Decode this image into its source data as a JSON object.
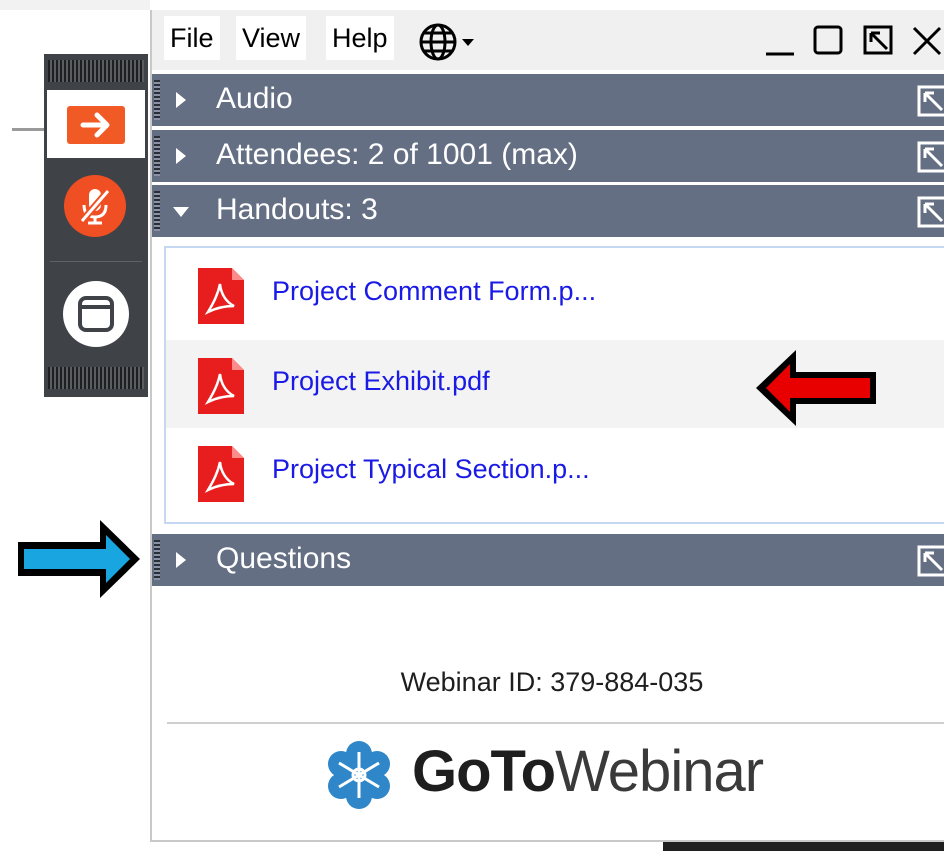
{
  "menu": {
    "file": "File",
    "view": "View",
    "help": "Help",
    "language_icon": "globe-icon"
  },
  "window_controls": [
    "minimize-icon",
    "maximize-icon",
    "popout-icon",
    "close-icon"
  ],
  "dock": {
    "buttons": [
      {
        "name": "leave-session",
        "icon": "exit-arrow-icon",
        "color": "#f15a24"
      },
      {
        "name": "microphone",
        "icon": "muted-mic-icon",
        "color": "#f04e23"
      },
      {
        "name": "show-panel",
        "icon": "window-icon",
        "color": "#ffffff"
      }
    ]
  },
  "sections": {
    "audio": "Audio",
    "attendees": "Attendees:  2 of 1001 (max)",
    "handouts": "Handouts: 3",
    "questions": "Questions"
  },
  "handouts": [
    {
      "name": "Project Comment Form.p..."
    },
    {
      "name": "Project Exhibit.pdf"
    },
    {
      "name": "Project Typical Section.p..."
    }
  ],
  "webinar_id": "Webinar ID: 379-884-035",
  "brand": {
    "bold": "GoTo",
    "light": "Webinar"
  },
  "colors": {
    "section_header": "#656f84",
    "link": "#1a1ae6",
    "accent_orange": "#f15a24",
    "annotation_red": "#e80000",
    "annotation_blue": "#19a5e0"
  }
}
